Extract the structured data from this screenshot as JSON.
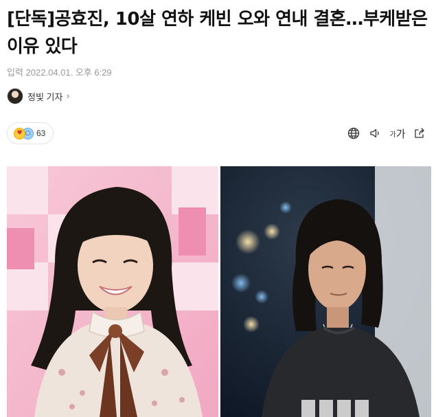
{
  "article": {
    "headline": "[단독]공효진, 10살 연하 케빈 오와 연내 결혼…부케받은 이유 있다",
    "meta": "입력 2022.04.01. 오후 6:29",
    "reporter": {
      "name": "정빛 기자",
      "chevron": "›"
    }
  },
  "reactions": {
    "icons": [
      "love-emoji",
      "surprised-emoji"
    ],
    "count": "63"
  },
  "toolbar": {
    "icons": [
      "globe-icon",
      "speaker-icon",
      "font-size-icon",
      "share-icon"
    ],
    "font_small": "가",
    "font_big": "가"
  },
  "photo": {
    "left": "woman-smiling-in-floral-blouse",
    "right": "man-with-long-hair-at-night"
  },
  "colors": {
    "headline": "#111111",
    "meta": "#9a9a9a",
    "pink_backdrop": "#f4b6cc",
    "night_backdrop": "#0e1a2a"
  }
}
